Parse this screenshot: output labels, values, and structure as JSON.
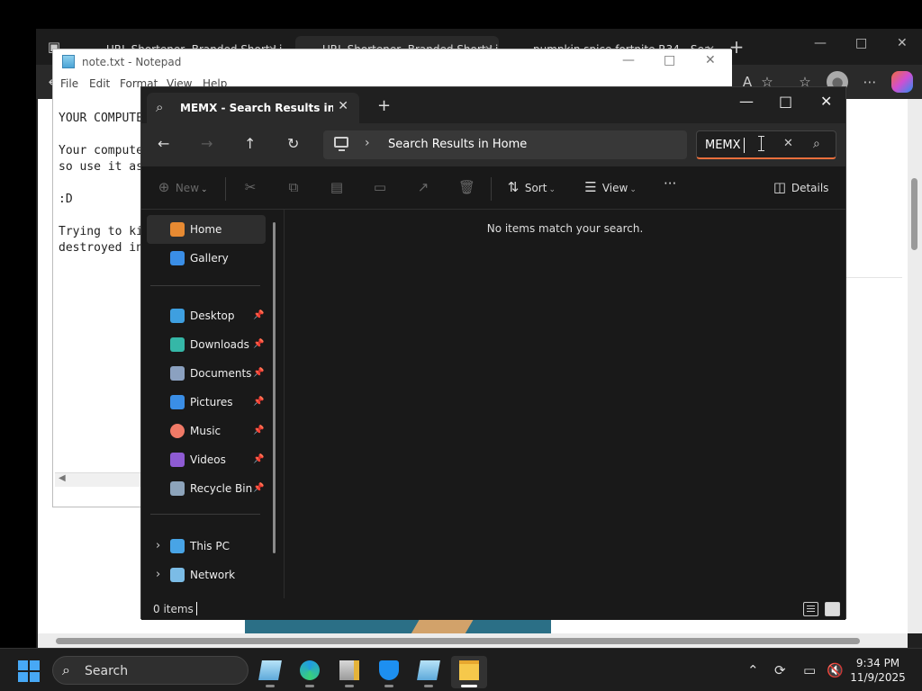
{
  "browser": {
    "tabs": [
      {
        "title": "URL Shortener, Branded Short Lin"
      },
      {
        "title": "URL Shortener, Branded Short Lin"
      },
      {
        "title": "pumpkin spice fortnite R34 - Sea"
      }
    ],
    "new_tab_label": "+",
    "toolbar_icons": [
      "read-aloud-icon",
      "favorite-icon",
      "favorites-icon",
      "profile-icon",
      "more-icon",
      "copilot-icon"
    ]
  },
  "notepad": {
    "title": "note.txt - Notepad",
    "menu": [
      "File",
      "Edit",
      "Format",
      "View",
      "Help"
    ],
    "lines": [
      "YOUR COMPUTER",
      "",
      "Your compute",
      "so use it as",
      "",
      ":D",
      "",
      "Trying to ki",
      "destroyed in"
    ]
  },
  "explorer": {
    "tab_title": "MEMX - Search Results in Hon",
    "tab_close": "✕",
    "new_tab": "+",
    "address": {
      "path": "Search Results in Home"
    },
    "search": {
      "value": "MEMX"
    },
    "commands": {
      "new": "New",
      "sort": "Sort",
      "view": "View",
      "more": "···",
      "details": "Details"
    },
    "sidebar": {
      "top": [
        {
          "label": "Home",
          "icon": "home-icon",
          "color": "#e78a32"
        },
        {
          "label": "Gallery",
          "icon": "gallery-icon",
          "color": "#3a8ee6"
        }
      ],
      "pinned": [
        {
          "label": "Desktop",
          "icon": "desktop-folder-icon",
          "color": "#3e9fe0"
        },
        {
          "label": "Downloads",
          "icon": "downloads-icon",
          "color": "#35b7a7"
        },
        {
          "label": "Documents",
          "icon": "documents-icon",
          "color": "#8ba1c0"
        },
        {
          "label": "Pictures",
          "icon": "pictures-icon",
          "color": "#3a8ee6"
        },
        {
          "label": "Music",
          "icon": "music-icon",
          "color": "#f07a67"
        },
        {
          "label": "Videos",
          "icon": "videos-icon",
          "color": "#8e5bd3"
        },
        {
          "label": "Recycle Bin",
          "icon": "recycle-bin-icon",
          "color": "#8da4bb"
        }
      ],
      "bottom": [
        {
          "label": "This PC",
          "icon": "pc-icon",
          "color": "#48a4e6"
        },
        {
          "label": "Network",
          "icon": "network-icon",
          "color": "#7bbce6"
        }
      ]
    },
    "empty_message": "No items match your search.",
    "status": {
      "count": "0 items"
    }
  },
  "taskbar": {
    "search_label": "Search",
    "apps": [
      {
        "name": "notepad-app",
        "color": "#77b7e5"
      },
      {
        "name": "edge-app",
        "color": "#1f9be3"
      },
      {
        "name": "file-lock-app",
        "color": "#c8c8c8"
      },
      {
        "name": "defender-app",
        "color": "#1d8ff0"
      },
      {
        "name": "notepad-app-2",
        "color": "#77b7e5"
      },
      {
        "name": "file-explorer-app",
        "color": "#f6c84b"
      }
    ],
    "clock": {
      "time": "9:34 PM",
      "date": "11/9/2025"
    }
  },
  "colors": {
    "accent": "#e96f3c",
    "explorer_bg": "#191919",
    "taskbar_bg": "#1d1d1d"
  }
}
